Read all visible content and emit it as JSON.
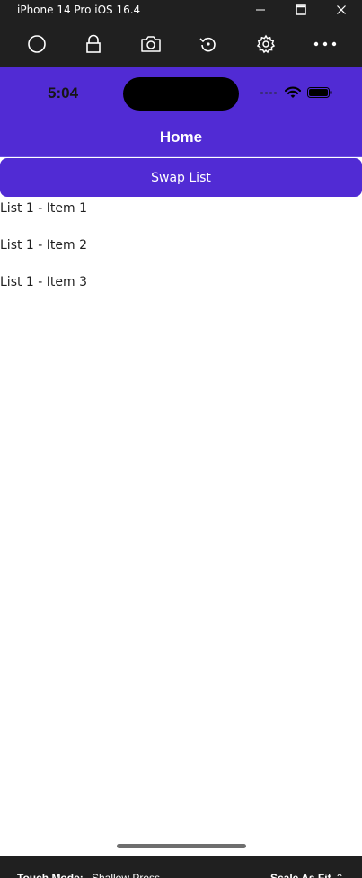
{
  "window": {
    "title": "iPhone 14 Pro iOS 16.4",
    "minimize_icon": "minimize-icon",
    "maximize_icon": "maximize-icon",
    "close_icon": "close-icon"
  },
  "toolbar": {
    "icons": [
      "home-icon",
      "lock-icon",
      "camera-icon",
      "rotate-icon",
      "settings-icon",
      "more-icon"
    ]
  },
  "device": {
    "status_time": "5:04",
    "nav_title": "Home",
    "accent_color": "#512bd4"
  },
  "main": {
    "swap_button_label": "Swap List",
    "list_items": [
      "List 1 - Item 1",
      "List 1 - Item 2",
      "List 1 - Item 3"
    ]
  },
  "bottombar": {
    "touch_mode_label": "Touch Mode:",
    "touch_mode_value": "Shallow Press",
    "scale_label": "Scale As Fit",
    "scale_chevron": "⌃"
  }
}
